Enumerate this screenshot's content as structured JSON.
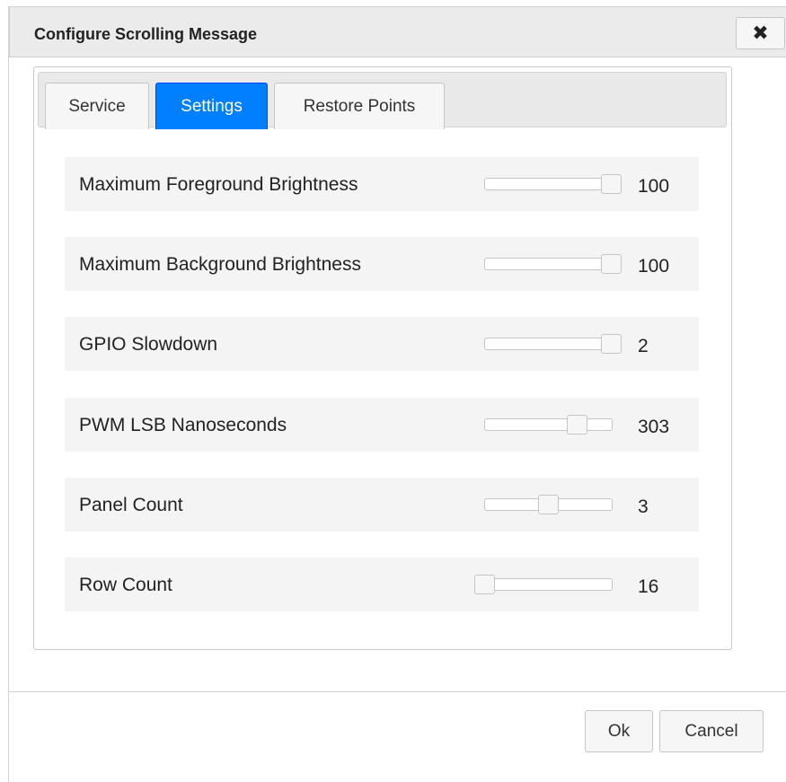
{
  "dialog": {
    "title": "Configure Scrolling Message",
    "close_icon": "close-x-icon"
  },
  "tabs": [
    {
      "label": "Service",
      "active": false
    },
    {
      "label": "Settings",
      "active": true
    },
    {
      "label": "Restore Points",
      "active": false
    }
  ],
  "settings": [
    {
      "label": "Maximum Foreground Brightness",
      "value": "100",
      "slider_fraction": 1.0
    },
    {
      "label": "Maximum Background Brightness",
      "value": "100",
      "slider_fraction": 1.0
    },
    {
      "label": "GPIO Slowdown",
      "value": "2",
      "slider_fraction": 1.0
    },
    {
      "label": "PWM LSB Nanoseconds",
      "value": "303",
      "slider_fraction": 0.73
    },
    {
      "label": "Panel Count",
      "value": "3",
      "slider_fraction": 0.5
    },
    {
      "label": "Row Count",
      "value": "16",
      "slider_fraction": 0.0
    }
  ],
  "footer": {
    "ok_label": "Ok",
    "cancel_label": "Cancel"
  },
  "colors": {
    "active_tab": "#007fff",
    "titlebar": "#ebebeb",
    "row_background": "#f4f4f4"
  }
}
